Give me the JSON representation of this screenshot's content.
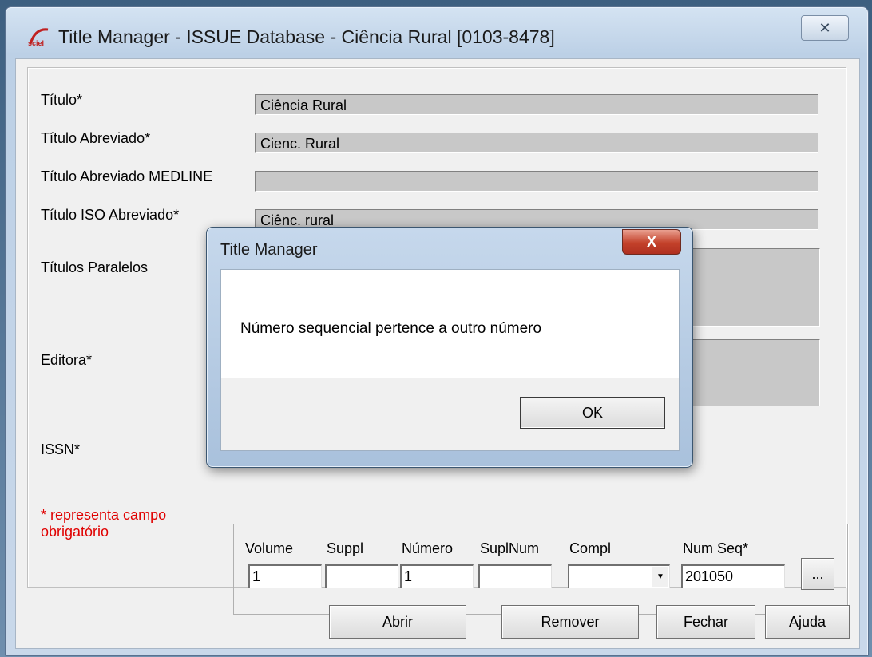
{
  "window": {
    "title": "Title Manager - ISSUE Database - Ciência Rural [0103-8478]",
    "close_glyph": "✕"
  },
  "form": {
    "titulo_label": "Título*",
    "titulo_value": "Ciência Rural",
    "titulo_abrev_label": "Título Abreviado*",
    "titulo_abrev_value": "Cienc. Rural",
    "medline_label": "Título Abreviado MEDLINE",
    "medline_value": "",
    "iso_label": "Título ISO Abreviado*",
    "iso_value": "Ciênc. rural",
    "paralelos_label": "Títulos Paralelos",
    "editora_label": "Editora*",
    "issn_label": "ISSN*",
    "required_note": "* representa campo obrigatório"
  },
  "issue": {
    "volume_label": "Volume",
    "volume_value": "1",
    "suppl_label": "Suppl",
    "suppl_value": "",
    "numero_label": "Número",
    "numero_value": "1",
    "suplnum_label": "SuplNum",
    "suplnum_value": "",
    "compl_label": "Compl",
    "compl_value": "",
    "numseq_label": "Num Seq*",
    "numseq_value": "201050",
    "more_label": "..."
  },
  "buttons": {
    "abrir": "Abrir",
    "remover": "Remover",
    "fechar": "Fechar",
    "ajuda": "Ajuda"
  },
  "dialog": {
    "title": "Title Manager",
    "close_glyph": "X",
    "message": "Número sequencial pertence a outro número",
    "ok": "OK"
  },
  "colors": {
    "required_text": "#e00000",
    "dialog_close": "#c3412a"
  },
  "icons": [
    "app-logo-icon",
    "close-icon",
    "dropdown-arrow-icon"
  ]
}
